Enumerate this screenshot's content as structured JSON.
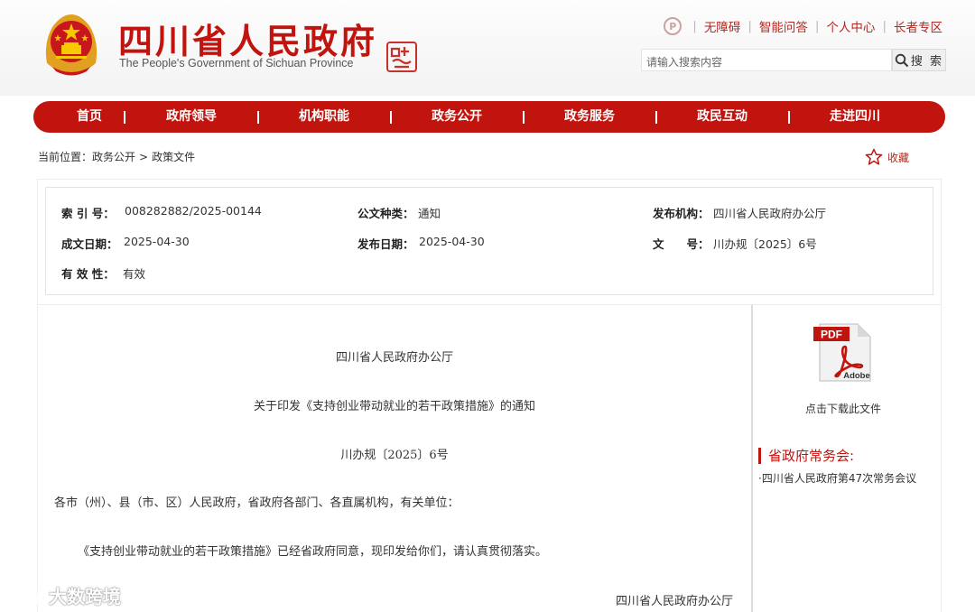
{
  "header": {
    "title": "四川省人民政府",
    "subtitle": "The People's Government of Sichuan Province",
    "top_links": [
      "无障碍",
      "智能问答",
      "个人中心",
      "长者专区"
    ],
    "search_placeholder": "请输入搜索内容",
    "search_button": "搜 索"
  },
  "nav": {
    "items": [
      "首页",
      "政府领导",
      "机构职能",
      "政务公开",
      "政务服务",
      "政民互动",
      "走进四川"
    ]
  },
  "breadcrumb": {
    "prefix": "当前位置：",
    "items": [
      "政务公开",
      "政策文件"
    ],
    "separator": ">"
  },
  "favorite_label": "收藏",
  "info": {
    "index_label": "索 引 号：",
    "index_value": "008282882/2025-00144",
    "type_label": "公文种类：",
    "type_value": "通知",
    "issuer_label": "发布机构：",
    "issuer_value": "四川省人民政府办公厅",
    "written_label": "成文日期：",
    "written_value": "2025-04-30",
    "published_label": "发布日期：",
    "published_value": "2025-04-30",
    "docno_label": "文　　号：",
    "docno_value": "川办规〔2025〕6号",
    "validity_label": "有 效 性：",
    "validity_value": "有效"
  },
  "document": {
    "issuer": "四川省人民政府办公厅",
    "title": "关于印发《支持创业带动就业的若干政策措施》的通知",
    "number": "川办规〔2025〕6号",
    "salutation": "各市（州）、县（市、区）人民政府，省政府各部门、各直属机构，有关单位：",
    "body": "《支持创业带动就业的若干政策措施》已经省政府同意，现印发给你们，请认真贯彻落实。",
    "signature": "四川省人民政府办公厅"
  },
  "sidebar": {
    "pdf_label": "点击下载此文件",
    "meeting_heading": "省政府常务会:",
    "meeting_item": "·四川省人民政府第47次常务会议"
  },
  "watermark": "大数跨境",
  "colors": {
    "primary_red": "#c1140e",
    "link_red": "#b12a22"
  }
}
